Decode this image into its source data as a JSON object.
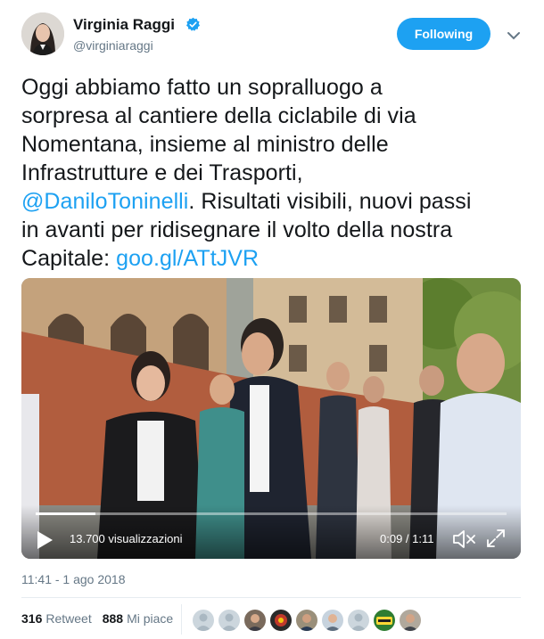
{
  "author": {
    "name": "Virginia Raggi",
    "handle": "@virginiaraggi",
    "verified_icon": "verified-badge-icon",
    "follow_label": "Following"
  },
  "tweet": {
    "lines": [
      "Oggi abbiamo fatto un sopralluogo a",
      "sorpresa al cantiere della ciclabile di via",
      "Nomentana, insieme al ministro delle",
      "Infrastrutture e dei Trasporti,"
    ],
    "mention": "@DaniloToninelli",
    "after_mention": ". Risultati visibili, nuovi passi",
    "line6": "in avanti per ridisegnare il volto della nostra",
    "line7_prefix": "Capitale: ",
    "link": "goo.gl/ATtJVR"
  },
  "video": {
    "views": "13.700 visualizzazioni",
    "time": "0:09 / 1:11",
    "progress": 0.127
  },
  "timestamp": "11:41 - 1 ago 2018",
  "stats": {
    "retweets": "316",
    "retweets_label": "Retweet",
    "likes": "888",
    "likes_label": "Mi piace"
  },
  "likers": [
    "avatar-default",
    "avatar-default",
    "avatar-man-1",
    "avatar-logo",
    "avatar-man-2",
    "avatar-man-3",
    "avatar-default",
    "avatar-sticker",
    "avatar-man-4"
  ],
  "colors": {
    "accent": "#1da1f2",
    "text": "#14171a",
    "secondary": "#657786"
  }
}
